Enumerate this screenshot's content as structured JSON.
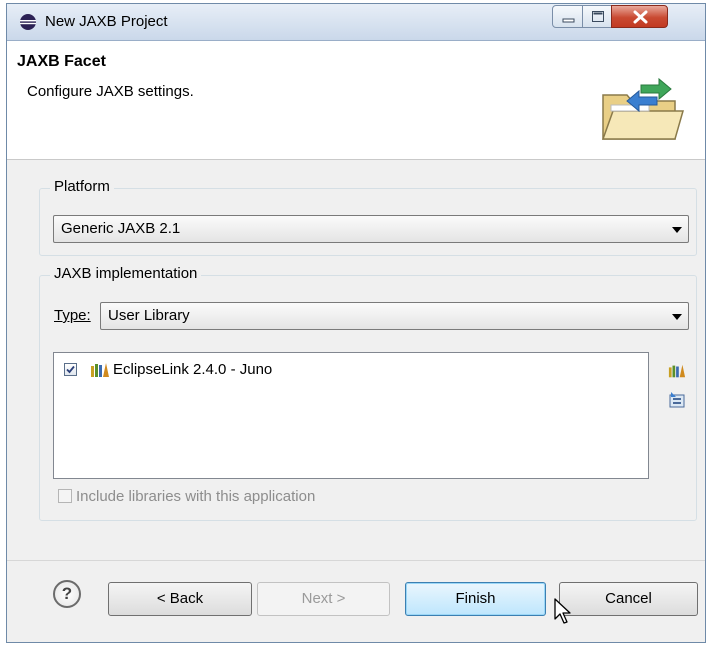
{
  "window": {
    "title": "New JAXB Project"
  },
  "banner": {
    "title": "JAXB Facet",
    "description": "Configure JAXB settings."
  },
  "platform": {
    "group_label": "Platform",
    "selected": "Generic JAXB 2.1"
  },
  "implementation": {
    "group_label": "JAXB implementation",
    "type_label": "Type:",
    "type_selected": "User Library",
    "libraries": [
      {
        "label": "EclipseLink 2.4.0 - Juno",
        "checked": true
      }
    ],
    "include_label": "Include libraries with this application",
    "include_checked": false
  },
  "buttons": {
    "help": "?",
    "back": "< Back",
    "next": "Next >",
    "finish": "Finish",
    "cancel": "Cancel"
  },
  "icons": {
    "title": "eclipse-icon",
    "banner": "folder-arrows-icon",
    "library": "library-books-icon",
    "manage": "manage-libraries-icon",
    "download": "download-library-icon"
  }
}
